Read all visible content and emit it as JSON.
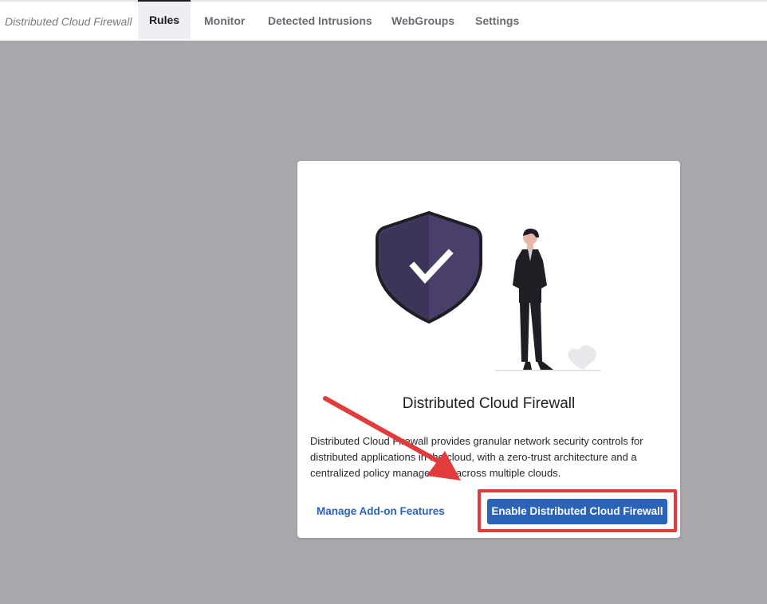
{
  "topnav": {
    "app_title": "Distributed Cloud Firewall",
    "tabs": [
      {
        "label": "Rules",
        "active": true
      },
      {
        "label": "Monitor",
        "active": false
      },
      {
        "label": "Detected Intrusions",
        "active": false
      },
      {
        "label": "WebGroups",
        "active": false
      },
      {
        "label": "Settings",
        "active": false
      }
    ]
  },
  "card": {
    "illustration_icons": [
      "shield-check-icon",
      "person-illustration",
      "heart-icon"
    ],
    "title": "Distributed Cloud Firewall",
    "description": "Distributed Cloud Firewall provides granular network security controls for distributed applications in the cloud, with a zero-trust architecture and a centralized policy management across multiple clouds.",
    "secondary_link": "Manage Add-on Features",
    "primary_button": "Enable Distributed Cloud Firewall"
  },
  "colors": {
    "backdrop": "#a9a7ab",
    "primary": "#2a63b8",
    "annotation": "#e23b3b",
    "shield": "#4a3f6b"
  }
}
